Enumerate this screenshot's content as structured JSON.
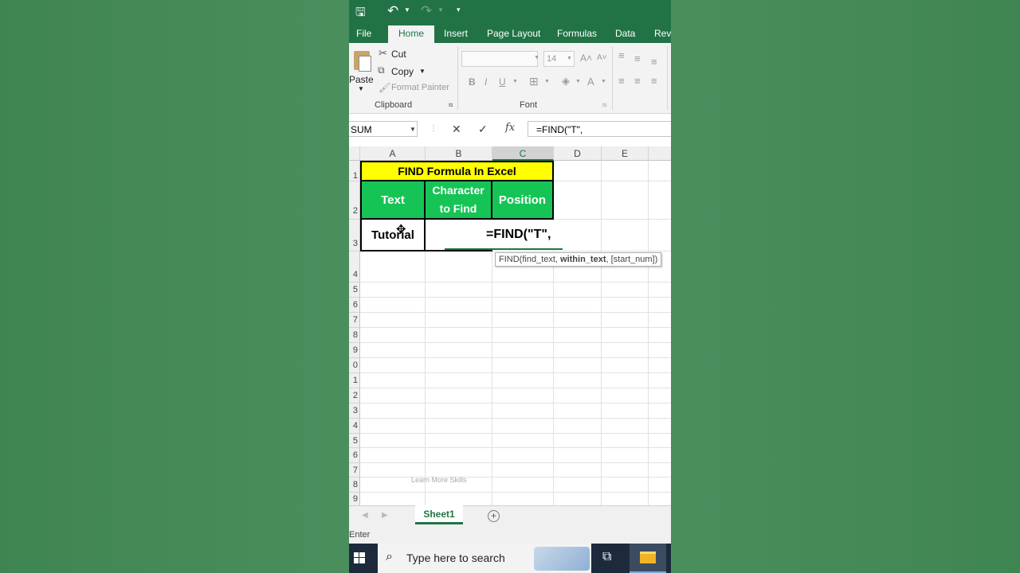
{
  "colors": {
    "excel_green": "#217346",
    "title_fill": "#ffff00",
    "header_fill": "#16c455",
    "header_text": "#ffffff"
  },
  "tabs": [
    "File",
    "Home",
    "Insert",
    "Page Layout",
    "Formulas",
    "Data",
    "Revi"
  ],
  "clipboard": {
    "paste": "Paste",
    "cut": "Cut",
    "copy": "Copy",
    "format_painter": "Format Painter",
    "group": "Clipboard"
  },
  "font": {
    "size": "14",
    "bold": "B",
    "italic": "I",
    "underline": "U",
    "group": "Font"
  },
  "formula_bar": {
    "name_box": "SUM",
    "cancel": "✕",
    "enter": "✓",
    "fx": "fx",
    "content": "=FIND(\"T\","
  },
  "columns": [
    "A",
    "B",
    "C",
    "D",
    "E"
  ],
  "rows": [
    "1",
    "2",
    "3",
    "4",
    "5",
    "6",
    "7",
    "8",
    "9",
    "0",
    "1",
    "2",
    "3",
    "4",
    "5",
    "6",
    "7",
    "8",
    "9"
  ],
  "cells": {
    "title": "FIND Formula In Excel",
    "h_text": "Text",
    "h_char": "Character to Find",
    "h_pos": "Position",
    "a3": "Tutorial",
    "editing": "=FIND(\"T\","
  },
  "tooltip": {
    "fn": "FIND(find_text, ",
    "arg": "within_text",
    "rest": ", [start_num])"
  },
  "watermark": "Learn More Skills",
  "sheet_tab": "Sheet1",
  "status": "Enter",
  "search_placeholder": "Type here to search"
}
